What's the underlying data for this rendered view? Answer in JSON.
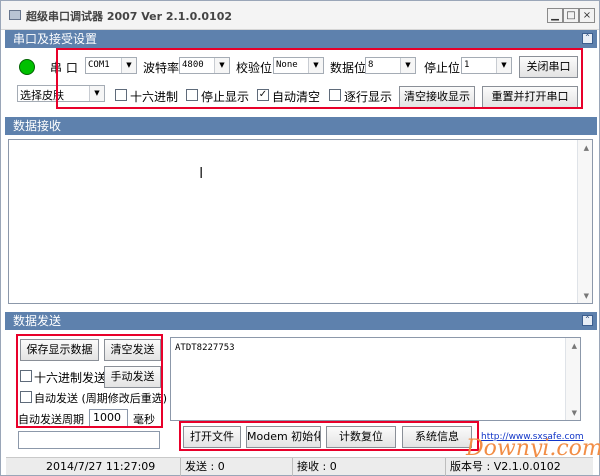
{
  "window": {
    "title": "超级串口调试器 2007   Ver 2.1.0.0102",
    "minimize": "▁",
    "restore": "□",
    "close": "×"
  },
  "sections": {
    "serial_settings": "串口及接受设置",
    "data_receive": "数据接收",
    "data_send": "数据发送",
    "collapse_icon": "⌃"
  },
  "serial": {
    "port_label": "串  口",
    "port_value": "COM1",
    "baud_label": "波特率",
    "baud_value": "4800",
    "parity_label": "校验位",
    "parity_value": "None",
    "databits_label": "数据位",
    "databits_value": "8",
    "stopbits_label": "停止位",
    "stopbits_value": "1",
    "close_port": "关闭串口",
    "skin_select": "选择皮肤",
    "hex_label": "十六进制",
    "stop_display_label": "停止显示",
    "auto_clear_label": "自动清空",
    "line_display_label": "逐行显示",
    "clear_receive": "清空接收显示",
    "reset_reopen": "重置并打开串口",
    "auto_clear_checked": true,
    "hex_checked": false,
    "stop_display_checked": false,
    "line_display_checked": false
  },
  "receive": {
    "content": ""
  },
  "send": {
    "save_display": "保存显示数据",
    "clear_send": "清空发送",
    "hex_send": "十六进制发送",
    "manual_send": "手动发送",
    "auto_send": "自动发送 (周期修改后重选)",
    "period_label": "自动发送周期",
    "period_value": "1000",
    "period_unit": "毫秒",
    "content": "ATDT8227753",
    "open_file": "打开文件",
    "modem_init": "Modem 初始化",
    "count_reset": "计数复位",
    "system_info": "系统信息",
    "site_link": "http://www.sxsafe.com",
    "hex_send_checked": false,
    "auto_send_checked": false
  },
  "status": {
    "datetime": "2014/7/27 11:27:09",
    "sent": "发送 : 0",
    "received": "接收 : 0",
    "version": "版本号 : V2.1.0.0102"
  },
  "watermark": "Downyi.com",
  "colors": {
    "section_bar": "#5e81ad",
    "highlight_border": "#e8002a",
    "status_light": "#00c000"
  }
}
